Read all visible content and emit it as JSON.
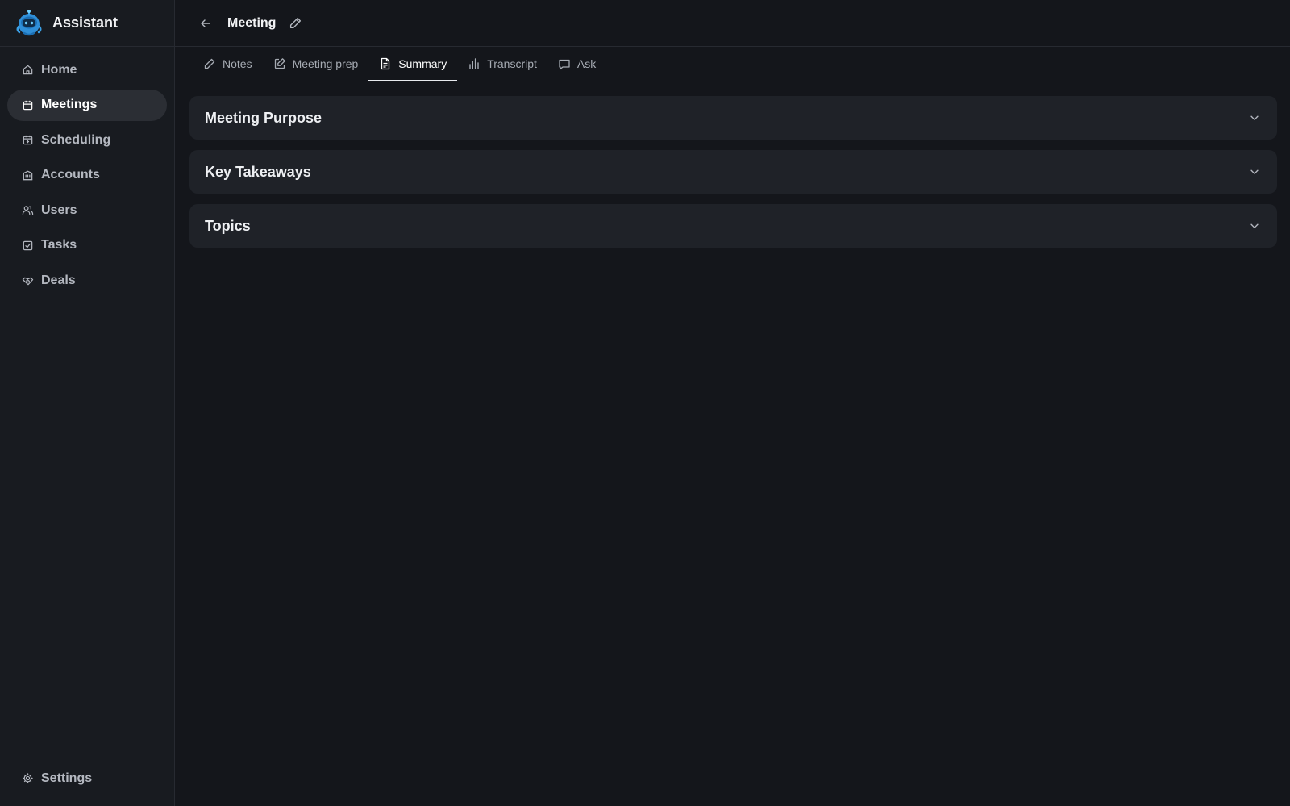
{
  "app": {
    "name": "Assistant"
  },
  "sidebar": {
    "items": [
      {
        "label": "Home",
        "icon": "home-icon",
        "active": false
      },
      {
        "label": "Meetings",
        "icon": "calendar-icon",
        "active": true
      },
      {
        "label": "Scheduling",
        "icon": "calendar-plus-icon",
        "active": false
      },
      {
        "label": "Accounts",
        "icon": "building-icon",
        "active": false
      },
      {
        "label": "Users",
        "icon": "users-icon",
        "active": false
      },
      {
        "label": "Tasks",
        "icon": "checkbox-icon",
        "active": false
      },
      {
        "label": "Deals",
        "icon": "handshake-icon",
        "active": false
      }
    ],
    "settings_label": "Settings"
  },
  "header": {
    "title": "Meeting"
  },
  "tabs": [
    {
      "label": "Notes",
      "icon": "pencil-icon",
      "active": false
    },
    {
      "label": "Meeting prep",
      "icon": "edit-square-icon",
      "active": false
    },
    {
      "label": "Summary",
      "icon": "document-icon",
      "active": true
    },
    {
      "label": "Transcript",
      "icon": "bar-chart-icon",
      "active": false
    },
    {
      "label": "Ask",
      "icon": "chat-icon",
      "active": false
    }
  ],
  "sections": [
    {
      "title": "Meeting Purpose"
    },
    {
      "title": "Key Takeaways"
    },
    {
      "title": "Topics"
    }
  ],
  "colors": {
    "background": "#14161b",
    "sidebar": "#181b20",
    "active_nav": "#2b2e34",
    "card": "#1f2228",
    "logo_accent": "#3aa0e6"
  }
}
